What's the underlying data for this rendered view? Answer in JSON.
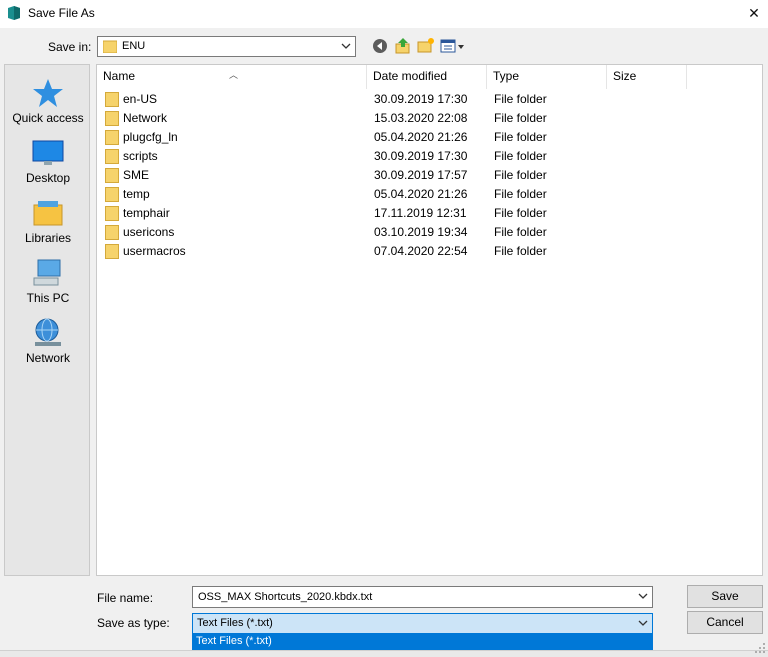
{
  "window": {
    "title": "Save File As",
    "close": "✕"
  },
  "toolbar": {
    "save_in_label": "Save in:",
    "current_folder": "ENU",
    "icons": [
      "back-icon",
      "up-folder-icon",
      "new-folder-icon",
      "view-menu-icon"
    ]
  },
  "places": [
    {
      "label": "Quick access",
      "icon": "star-icon"
    },
    {
      "label": "Desktop",
      "icon": "desktop-icon"
    },
    {
      "label": "Libraries",
      "icon": "libraries-icon"
    },
    {
      "label": "This PC",
      "icon": "computer-icon"
    },
    {
      "label": "Network",
      "icon": "network-icon"
    }
  ],
  "columns": {
    "name": "Name",
    "date": "Date modified",
    "type": "Type",
    "size": "Size"
  },
  "files": [
    {
      "name": "en-US",
      "date": "30.09.2019 17:30",
      "type": "File folder"
    },
    {
      "name": "Network",
      "date": "15.03.2020 22:08",
      "type": "File folder"
    },
    {
      "name": "plugcfg_ln",
      "date": "05.04.2020 21:26",
      "type": "File folder"
    },
    {
      "name": "scripts",
      "date": "30.09.2019 17:30",
      "type": "File folder"
    },
    {
      "name": "SME",
      "date": "30.09.2019 17:57",
      "type": "File folder"
    },
    {
      "name": "temp",
      "date": "05.04.2020 21:26",
      "type": "File folder"
    },
    {
      "name": "temphair",
      "date": "17.11.2019 12:31",
      "type": "File folder"
    },
    {
      "name": "usericons",
      "date": "03.10.2019 19:34",
      "type": "File folder"
    },
    {
      "name": "usermacros",
      "date": "07.04.2020 22:54",
      "type": "File folder"
    }
  ],
  "form": {
    "file_name_label": "File name:",
    "file_name_value": "OSS_MAX Shortcuts_2020.kbdx.txt",
    "save_as_type_label": "Save as type:",
    "save_as_type_value": "Text Files (*.txt)",
    "dropdown_option": "Text Files (*.txt)"
  },
  "buttons": {
    "save": "Save",
    "cancel": "Cancel"
  },
  "colors": {
    "accent": "#0078d7",
    "selection_bg": "#cce4f7",
    "folder": "#f6d36b"
  }
}
